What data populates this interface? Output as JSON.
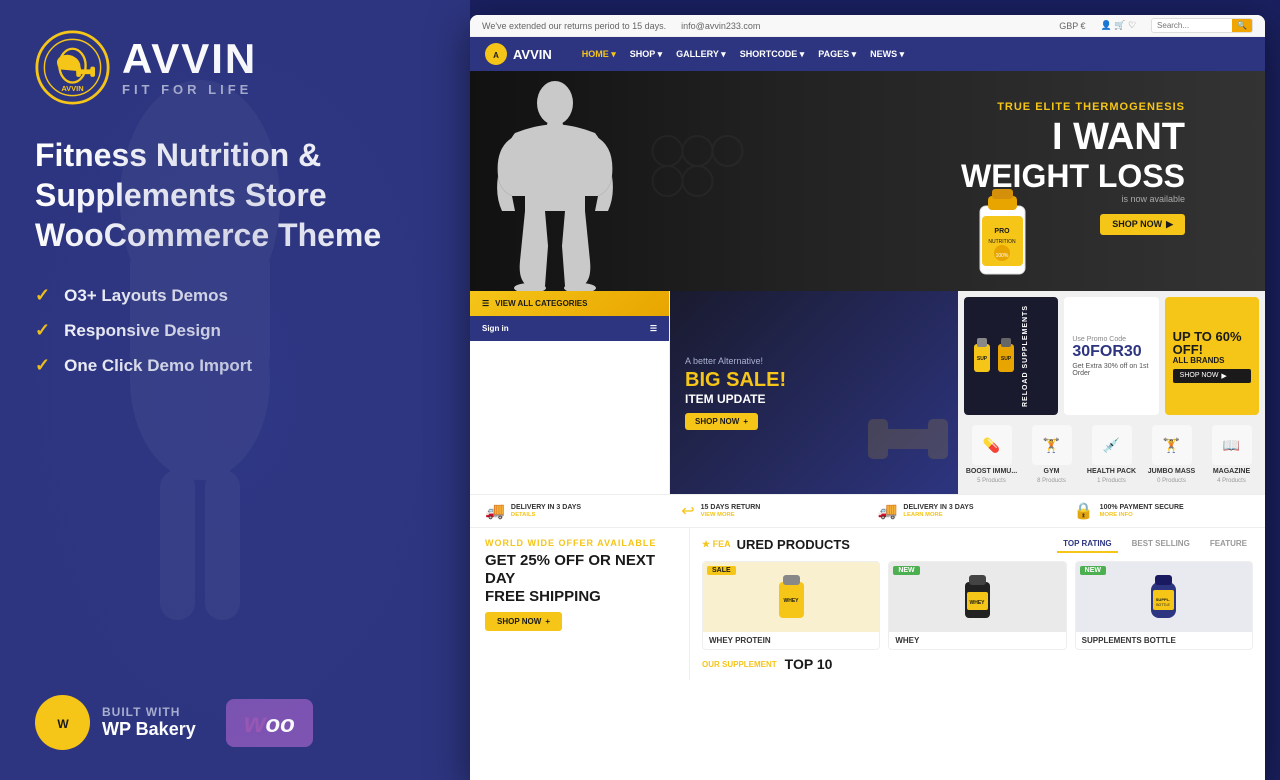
{
  "app": {
    "title": "Avvin - Fitness Nutrition & Supplements Store WooCommerce Theme"
  },
  "left": {
    "logo": {
      "title": "AVVIN",
      "subtitle": "FIT FOR LIFE"
    },
    "tagline": "Fitness Nutrition & Supplements Store WooCommerce Theme",
    "features": [
      "O3+ Layouts Demos",
      "Responsive Design",
      "One Click Demo Import"
    ],
    "built_with_label": "BUILT WITH",
    "bakery_name": "WP Bakery",
    "woo_label": "Woo"
  },
  "site": {
    "top_bar": {
      "announcement": "We've extended our returns period to 15 days.",
      "email": "info@avvin233.com",
      "currency": "GBP €"
    },
    "nav": {
      "logo": "AVVIN",
      "links": [
        "HOME",
        "SHOP",
        "GALLERY",
        "SHORTCODE",
        "PAGES",
        "NEWS"
      ],
      "search_placeholder": "Search..."
    },
    "hero": {
      "subtitle": "TRUE ELITE THERMOGENESIS",
      "line1": "I WANT",
      "line2": "WEIGHT LOSS",
      "is_now": "is now available",
      "shop_btn": "SHOP NOW"
    },
    "sale_banner": {
      "alt_text": "A better Alternative!",
      "big_sale": "BIG SALE!",
      "item_update": "ITEM UPDATE",
      "shop_btn": "SHOP NOW"
    },
    "promo": {
      "reload_text": "RELOAD SUPPLEMENTS",
      "use_promo": "Use Promo Code",
      "code": "30FOR30",
      "desc": "Get Extra 30% off on 1st Order",
      "sixty_off": "UP TO 60% OFF!",
      "all_brands": "ALL BRANDS",
      "shop_btn": "SHOP NOW"
    },
    "trust": [
      {
        "icon": "🚚",
        "title": "DELIVERY IN 3 DAYS",
        "sub": "DETAILS"
      },
      {
        "icon": "↩",
        "title": "15 DAYS RETURN",
        "sub": "VIEW MORE"
      },
      {
        "icon": "🚚",
        "title": "DELIVERY IN 3 DAYS",
        "sub": "LEARN MORE"
      },
      {
        "icon": "🔒",
        "title": "100% PAYMENT SECURE",
        "sub": "MORE INFO"
      }
    ],
    "categories": [
      {
        "icon": "💊",
        "name": "BOOST IMMU...",
        "count": "5 Products"
      },
      {
        "icon": "🏋",
        "name": "GYM",
        "count": "8 Products"
      },
      {
        "icon": "💉",
        "name": "HEALTH PACK",
        "count": "1 Products"
      },
      {
        "icon": "🏋",
        "name": "JUMBO MASS",
        "count": "0 Products"
      },
      {
        "icon": "📖",
        "name": "MAGAZINE",
        "count": "4 Products"
      }
    ],
    "offer": {
      "world_wide": "WORLD WIDE OFFER AVAILABLE",
      "title_line1": "GET 25% OFF OR NEXT DAY",
      "title_line2": "FREE SHIPPING",
      "shop_btn": "SHOP NOW"
    },
    "featured": {
      "title": "URED PRODUCTS",
      "tabs": [
        "TOP RATING",
        "BEST SELLING",
        "FEATURE"
      ],
      "active_tab": "TOP RATING"
    },
    "products": [
      {
        "name": "WHEY PROTEIN",
        "badge": "SALE",
        "badge_type": "sale",
        "emoji": "🥤"
      },
      {
        "name": "WHEY",
        "badge": "NEW",
        "badge_type": "new",
        "emoji": "🥤"
      },
      {
        "name": "SUPPLEMENTS BOTTLE",
        "badge": "NEW",
        "badge_type": "new",
        "emoji": "💊"
      }
    ],
    "supplement_label": "OUR SUPPLEMENT",
    "top10_label": "TOP 10"
  }
}
